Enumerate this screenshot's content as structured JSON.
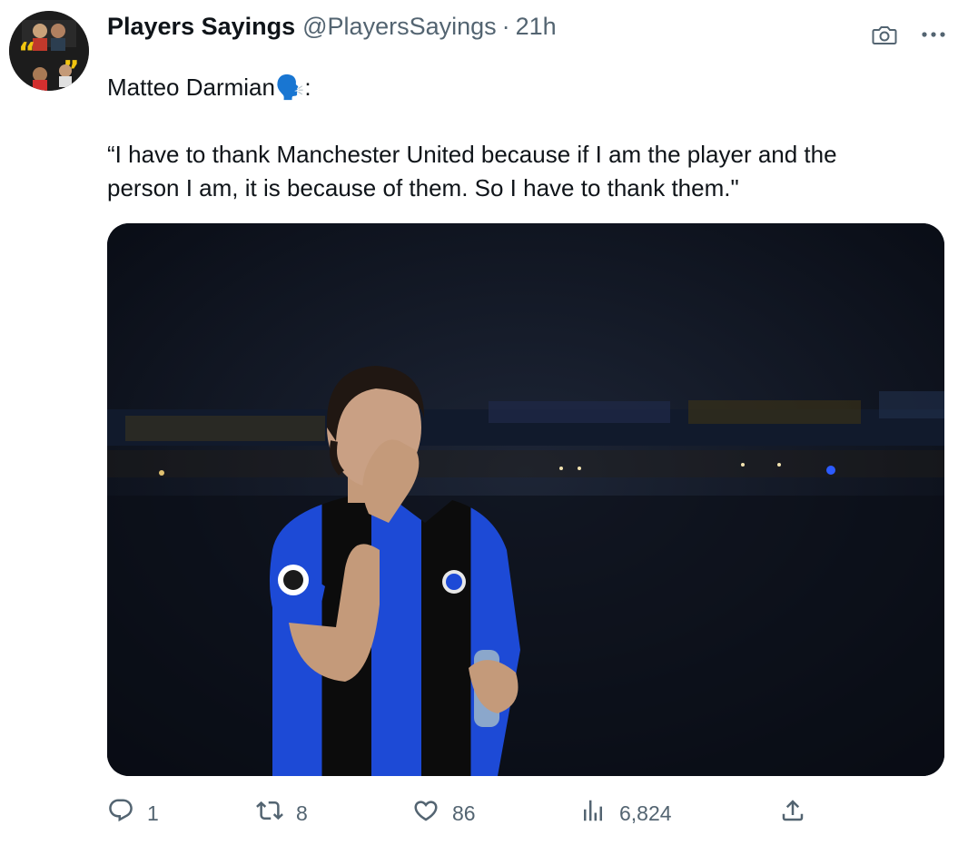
{
  "tweet": {
    "author_name": "Players Sayings",
    "author_handle": "@PlayersSayings",
    "separator": "·",
    "timestamp": "21h",
    "text_line1": "Matteo Darmian🗣️:",
    "text_line2": "“I have to thank Manchester United because if I am the player and the",
    "text_line3": "person I am, it is because of them. So I have to thank them.\""
  },
  "actions": {
    "reply_count": "1",
    "retweet_count": "8",
    "like_count": "86",
    "views_count": "6,824"
  },
  "icons": [
    "camera-icon",
    "more-icon",
    "reply-icon",
    "retweet-icon",
    "like-icon",
    "views-icon",
    "share-icon"
  ],
  "colors": {
    "text": "#0f1419",
    "secondary": "#536471",
    "jersey_blue": "#1f4fd8",
    "jersey_black": "#0a0a0a"
  }
}
